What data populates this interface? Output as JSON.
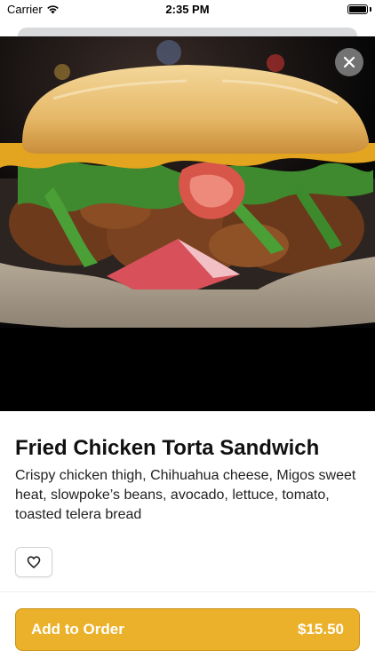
{
  "status_bar": {
    "carrier": "Carrier",
    "time": "2:35 PM",
    "wifi_icon": "wifi-icon",
    "battery_icon": "battery-icon"
  },
  "hero": {
    "image": "fried-chicken-torta-photo",
    "close_icon": "close-icon"
  },
  "item": {
    "title": "Fried Chicken Torta Sandwich",
    "description": "Crispy chicken thigh, Chihuahua cheese, Migos sweet heat, slowpoke’s beans, avocado, lettuce, tomato, toasted telera bread",
    "favorite_icon": "heart-icon"
  },
  "order": {
    "label": "Add to Order",
    "price": "$15.50"
  },
  "colors": {
    "accent": "#ebb12a",
    "background": "#ffffff",
    "text": "#111111"
  }
}
